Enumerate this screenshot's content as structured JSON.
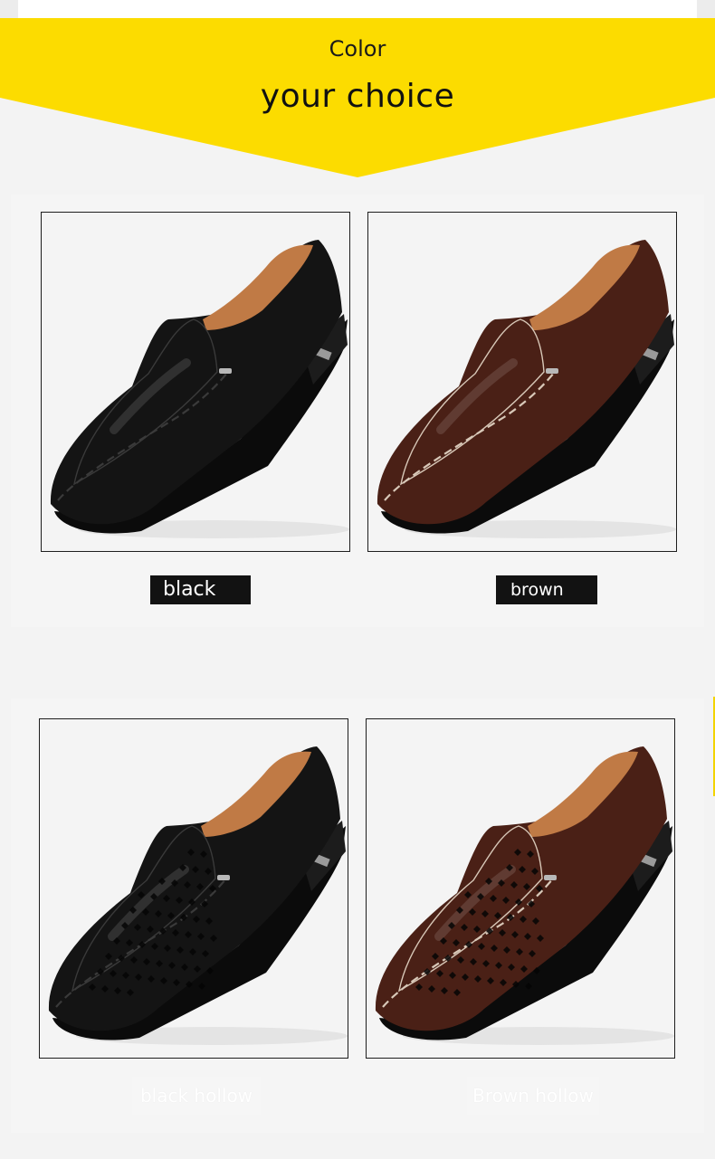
{
  "banner": {
    "small_text": "Color",
    "large_text": "your choice"
  },
  "variants": [
    {
      "label": "black",
      "leather": "#141414",
      "stitch": "#3a3a3a",
      "perforated": false
    },
    {
      "label": "brown",
      "leather": "#4a2016",
      "stitch": "#d8c8b8",
      "perforated": false
    },
    {
      "label": "black hollow",
      "leather": "#141414",
      "stitch": "#3a3a3a",
      "perforated": true
    },
    {
      "label": "Brown hollow",
      "leather": "#4a2016",
      "stitch": "#d8c8b8",
      "perforated": true
    }
  ],
  "colors": {
    "banner_yellow": "#fcdc00",
    "tag_background": "#121212",
    "lining": "#c07a45"
  }
}
